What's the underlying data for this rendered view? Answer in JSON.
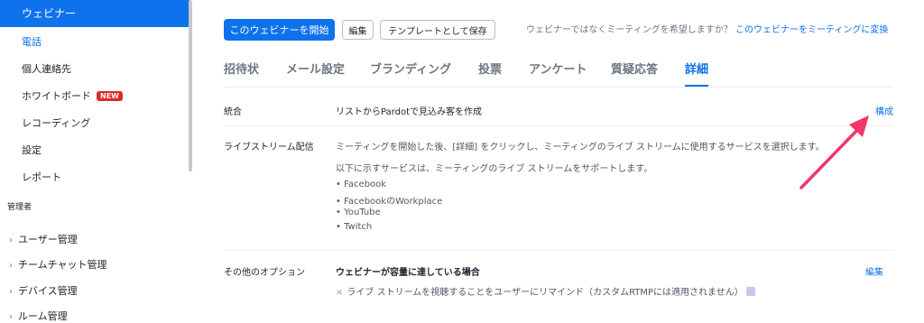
{
  "sidebar": {
    "active_item": "ウェビナー",
    "items": [
      "電話",
      "個人連絡先",
      "ホワイトボード",
      "レコーディング",
      "設定",
      "レポート"
    ],
    "new_badge": "NEW",
    "admin_section": "管理者",
    "admin_items": [
      "ユーザー管理",
      "チームチャット管理",
      "デバイス管理",
      "ルーム管理"
    ]
  },
  "toolbar": {
    "start_webinar": "このウェビナーを開始",
    "edit": "編集",
    "save_template": "テンプレートとして保存",
    "convert_question": "ウェビナーではなくミーティングを希望しますか？",
    "convert_link": "このウェビナーをミーティングに変換"
  },
  "tabs": [
    "招待状",
    "メール設定",
    "ブランディング",
    "投票",
    "アンケート",
    "質疑応答",
    "詳細"
  ],
  "rows": {
    "integration": {
      "label": "統合",
      "content": "リストからPardotで見込み客を作成",
      "action": "構成"
    },
    "livestream": {
      "label": "ライブストリーム配信",
      "desc1": "ミーティングを開始した後、[詳細] をクリックし、ミーティングのライブ ストリームに使用するサービスを選択します。",
      "desc2": "以下に示すサービスは、ミーティングのライブ ストリームをサポートします。",
      "services": [
        "Facebook",
        "FacebookのWorkplace",
        "YouTube",
        "Twitch"
      ]
    },
    "other": {
      "label": "その他のオプション",
      "title": "ウェビナーが容量に達している場合",
      "action": "編集",
      "option": "ライブ ストリームを視聴することをユーザーにリマインド（カスタムRTMPには適用されません）"
    }
  },
  "colors": {
    "accent": "#0e72ed",
    "arrow": "#f0366b",
    "badge": "#e02828"
  },
  "icons": {
    "chevron": "chevron-right-icon",
    "x": "x-icon",
    "info": "info-icon",
    "arrow": "pointer-arrow"
  }
}
